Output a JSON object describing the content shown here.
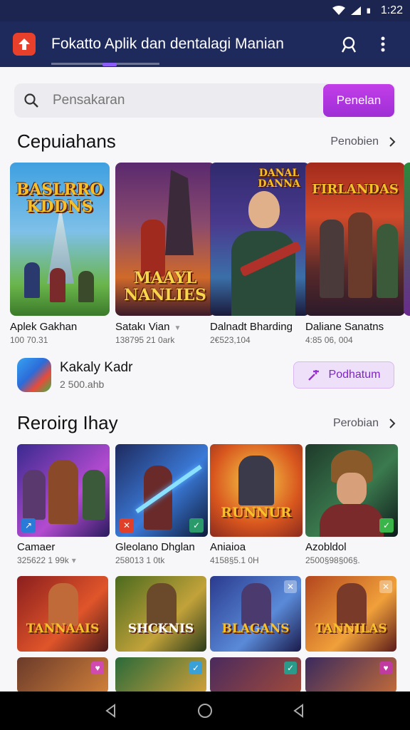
{
  "status_bar": {
    "time": "1:22"
  },
  "app_bar": {
    "title": "Fokatto Aplik dan dentalagi Manian"
  },
  "search": {
    "placeholder": "Pensakaran",
    "button_label": "Penelan"
  },
  "section1": {
    "title": "Cepuiahans",
    "more_label": "Penobien",
    "items": [
      {
        "name": "Aplek Gakhan",
        "meta": "100 70.31",
        "art_title": "BASLRRO KDDNS",
        "colors": [
          "#3fa0e0",
          "#a7d77a"
        ]
      },
      {
        "name": "Satakı Vian",
        "meta": "138795 21 0ark",
        "art_title": "MAAYL NANLIES",
        "colors": [
          "#5a2a6e",
          "#d06a2a"
        ]
      },
      {
        "name": "Dalnadt Bharding",
        "meta": "2€523,104",
        "art_title": "DANAL DANNA",
        "colors": [
          "#302a6e",
          "#3b6fa8"
        ]
      },
      {
        "name": "Daliane Sanatns",
        "meta": "4:85 06, 004",
        "art_title": "FIRLANDAS",
        "colors": [
          "#a32b1c",
          "#2b1a2a"
        ]
      }
    ]
  },
  "promo": {
    "name": "Kakaly Kadr",
    "sub": "2 500.ahb",
    "button_label": "Podhatum"
  },
  "section2": {
    "title": "Reroirg Ihay",
    "more_label": "Perobian",
    "items": [
      {
        "name": "Camaer",
        "meta": "325622 1 99k",
        "colors": [
          "#3a2a8e",
          "#b34bd0"
        ]
      },
      {
        "name": "Gleolano Dhglan",
        "meta": "258013 1 0tk",
        "colors": [
          "#1e2a5e",
          "#3b7ad8"
        ]
      },
      {
        "name": "Aniaioa",
        "meta": "4158§5.1 0H",
        "art_title": "RUNNUR",
        "colors": [
          "#d8561e",
          "#f2b233"
        ]
      },
      {
        "name": "Azobldol",
        "meta": "2500§98§06§.",
        "colors": [
          "#1e3a2a",
          "#3b7a4e"
        ]
      }
    ],
    "tiles": [
      {
        "art_title": "TANNAAIS",
        "colors": [
          "#8a1e1e",
          "#e0552a"
        ]
      },
      {
        "art_title": "SHCKNIS",
        "colors": [
          "#4a6a1e",
          "#c2a23a"
        ]
      },
      {
        "art_title": "BLAGANS",
        "colors": [
          "#2a3a8e",
          "#5a8ad8"
        ]
      },
      {
        "art_title": "TANNILAS",
        "colors": [
          "#b3461e",
          "#f0a03a"
        ]
      }
    ]
  },
  "colors": {
    "app_bar": "#1f2a5c",
    "accent": "#b638e4",
    "status_bar": "#1b2550"
  }
}
